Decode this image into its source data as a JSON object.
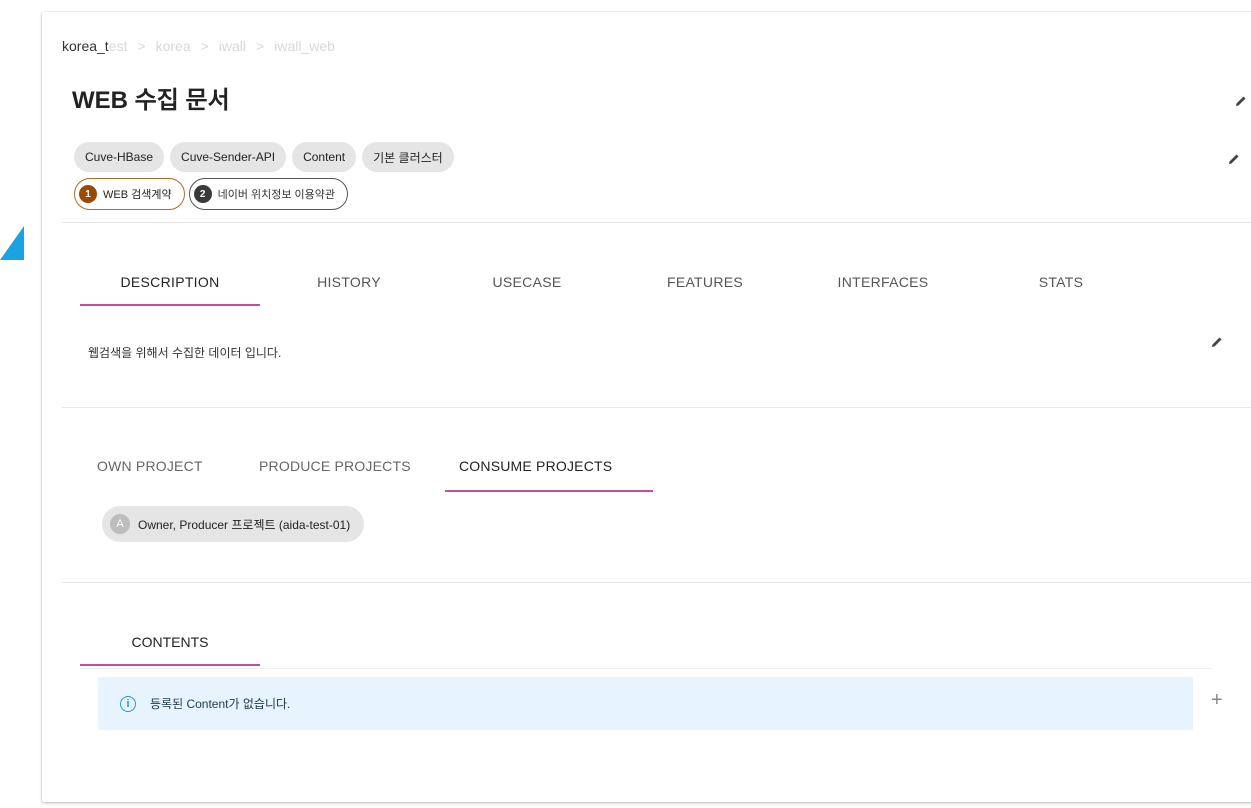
{
  "breadcrumb": {
    "items": [
      "korea_t",
      "est",
      "korea",
      "iwall",
      "iwall_web"
    ],
    "separator": ">"
  },
  "page": {
    "title": "WEB 수집 문서"
  },
  "tags": [
    "Cuve-HBase",
    "Cuve-Sender-API",
    "Content",
    "기본 클러스터"
  ],
  "terms": [
    {
      "number": "1",
      "label": "WEB 검색계약"
    },
    {
      "number": "2",
      "label": "네이버 위치정보 이용약관"
    }
  ],
  "tabs": [
    {
      "label": "DESCRIPTION",
      "active": true
    },
    {
      "label": "HISTORY",
      "active": false
    },
    {
      "label": "USECASE",
      "active": false
    },
    {
      "label": "FEATURES",
      "active": false
    },
    {
      "label": "INTERFACES",
      "active": false
    },
    {
      "label": "STATS",
      "active": false
    }
  ],
  "description": {
    "text": "웹검색을 위해서 수집한 데이터 입니다."
  },
  "projects": {
    "tabs": [
      {
        "label": "OWN PROJECT",
        "active": false
      },
      {
        "label": "PRODUCE PROJECTS",
        "active": false
      },
      {
        "label": "CONSUME PROJECTS",
        "active": true
      }
    ],
    "chip": {
      "avatar": "A",
      "label": "Owner, Producer 프로젝트 (aida-test-01)"
    }
  },
  "contents": {
    "tab_label": "CONTENTS",
    "info_icon": "i",
    "empty_message": "등록된 Content가 없습니다.",
    "add_label": "+"
  },
  "colors": {
    "accent": "#c24f9e",
    "arrow": "#1aa3e0",
    "info_bg": "#e8f4fd",
    "term1": "#9a4a06",
    "term2": "#3a3a3a"
  },
  "icons": [
    "pencil-icon",
    "info-icon",
    "plus-icon",
    "arrow-marker-icon"
  ]
}
